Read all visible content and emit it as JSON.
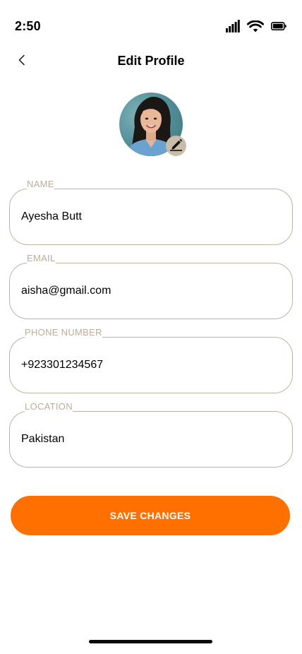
{
  "status_bar": {
    "time": "2:50",
    "icons": [
      "signal-icon",
      "wifi-icon",
      "battery-icon"
    ]
  },
  "header": {
    "back_icon": "chevron-left-icon",
    "title": "Edit Profile"
  },
  "avatar": {
    "edit_icon": "pencil-icon"
  },
  "form": {
    "name": {
      "label": "NAME",
      "value": "Ayesha Butt"
    },
    "email": {
      "label": "EMAIL",
      "value": "aisha@gmail.com"
    },
    "phone": {
      "label": "PHONE NUMBER",
      "value": "+923301234567"
    },
    "location": {
      "label": "LOCATION",
      "value": "Pakistan"
    }
  },
  "save_button": {
    "label": "SAVE CHANGES"
  },
  "colors": {
    "accent": "#ff7000",
    "field_border": "#bfb39f",
    "label": "#b9ad99"
  }
}
